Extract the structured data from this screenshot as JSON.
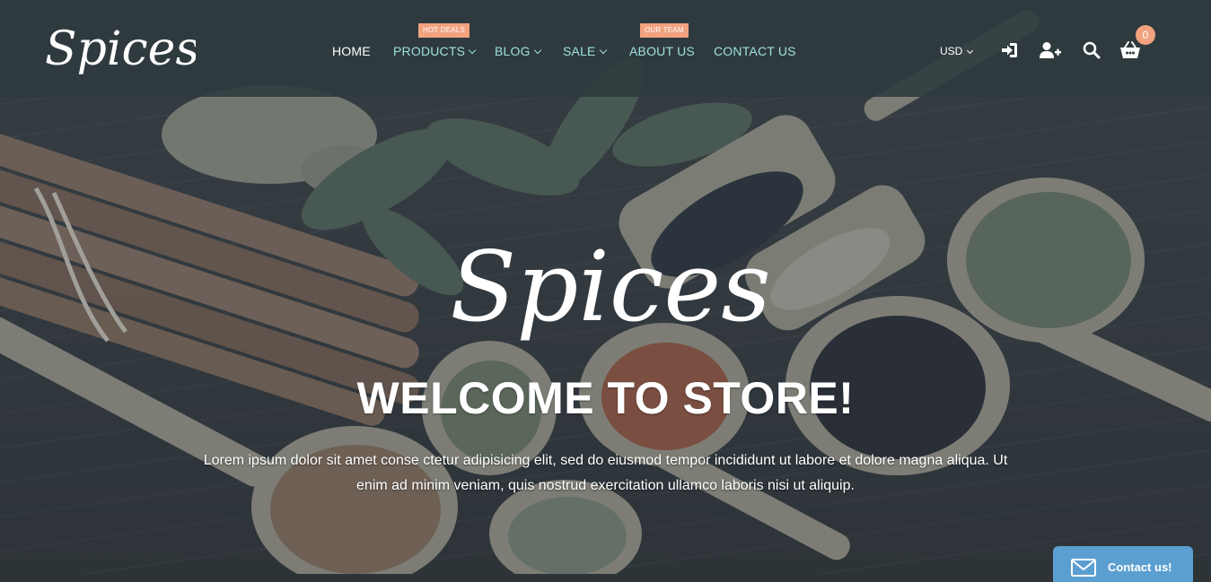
{
  "brand": {
    "name": "Spices"
  },
  "nav": {
    "items": [
      {
        "label": "HOME"
      },
      {
        "label": "PRODUCTS",
        "badge": "HOT DEALS"
      },
      {
        "label": "BLOG"
      },
      {
        "label": "SALE"
      },
      {
        "label": "ABOUT US",
        "badge": "OUR TEAM"
      },
      {
        "label": "CONTACT US"
      }
    ]
  },
  "header": {
    "currency": "USD",
    "cart_count": "0",
    "icons": [
      "sign-in-icon",
      "add-user-icon",
      "search-icon",
      "cart-icon"
    ]
  },
  "hero": {
    "script_title": "Spices",
    "title": "WELCOME TO STORE!",
    "text_line1": "Lorem ipsum dolor sit amet conse ctetur adipisicing elit, sed do eiusmod tempor incididunt ut labore et dolore magna aliqua. Ut",
    "text_line2": "enim ad minim veniam, quis nostrud exercitation ullamco laboris nisi ut aliquip."
  },
  "contact_widget": {
    "label": "Contact us!",
    "icon": "mail-icon"
  },
  "colors": {
    "accent": "#9fe0dc",
    "badge": "#f2a27f",
    "header_bg": "#2e3a3e",
    "widget_bg": "#5b9fd1"
  }
}
